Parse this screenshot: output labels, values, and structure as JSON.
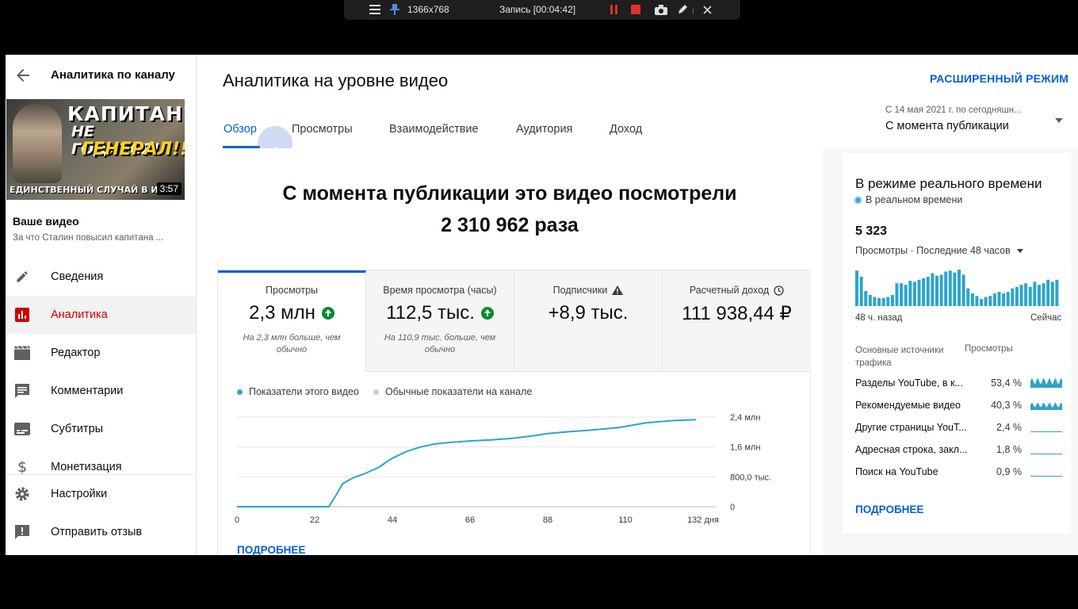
{
  "recorder": {
    "resolution": "1366x768",
    "status": "Запись [00:04:42]"
  },
  "sidebar": {
    "title": "Аналитика по каналу",
    "thumbnail": {
      "line1": "КАПИТАН?",
      "line2": "НЕ ГОДИТСЯ!",
      "line3": "ГЕНЕРАЛ!!!",
      "line4": "ЕДИНСТВЕННЫЙ СЛУЧАЙ В ИСТ",
      "duration": "3:57"
    },
    "video_label": "Ваше видео",
    "video_title": "За что Сталин повысил капитана ...",
    "items": [
      {
        "label": "Сведения",
        "icon": "pencil-icon"
      },
      {
        "label": "Аналитика",
        "icon": "analytics-icon",
        "active": true
      },
      {
        "label": "Редактор",
        "icon": "clapperboard-icon"
      },
      {
        "label": "Комментарии",
        "icon": "comment-icon"
      },
      {
        "label": "Субтитры",
        "icon": "subtitles-icon"
      },
      {
        "label": "Монетизация",
        "icon": "dollar-icon"
      }
    ],
    "bottom_items": [
      {
        "label": "Настройки",
        "icon": "gear-icon"
      },
      {
        "label": "Отправить отзыв",
        "icon": "feedback-icon"
      }
    ]
  },
  "header": {
    "title": "Аналитика на уровне видео",
    "advanced_mode": "РАСШИРЕННЫЙ РЕЖИМ",
    "tabs": [
      "Обзор",
      "Просмотры",
      "Взаимодействие",
      "Аудитория",
      "Доход"
    ],
    "date_range_sub": "С 14 мая 2021 г. по сегодняшн...",
    "date_range_value": "С момента публикации"
  },
  "overview": {
    "headline_line1": "С момента публикации это видео посмотрели",
    "headline_line2": "2 310 962 раза",
    "metrics": [
      {
        "title": "Просмотры",
        "value": "2,3 млн",
        "note": "На 2,3 млн больше, чем обычно",
        "trend": "up"
      },
      {
        "title": "Время просмотра (часы)",
        "value": "112,5 тыс.",
        "note": "На 110,9 тыс. больше, чем обычно",
        "trend": "up"
      },
      {
        "title": "Подписчики",
        "value": "+8,9 тыс.",
        "note": "",
        "trend": "warning"
      },
      {
        "title": "Расчетный доход",
        "value": "111 938,44 ₽",
        "note": "",
        "trend": "clock"
      }
    ],
    "legend": [
      "Показатели этого видео",
      "Обычные показатели на канале"
    ],
    "more": "ПОДРОБНЕЕ",
    "colors": {
      "series": "#2ea4c9",
      "typical": "#cccccc",
      "accent": "#065fd4"
    }
  },
  "chart_data": {
    "type": "line",
    "x_tick_labels": [
      "0",
      "22",
      "44",
      "66",
      "88",
      "110",
      "132 дня"
    ],
    "y_tick_labels": [
      "0",
      "800,0 тыс.",
      "1,6 млн",
      "2,4 млн"
    ],
    "xlim": [
      0,
      132
    ],
    "ylim": [
      0,
      2400000
    ],
    "series": [
      {
        "name": "Показатели этого видео",
        "x": [
          0,
          26,
          28,
          30,
          33,
          36,
          40,
          44,
          48,
          52,
          56,
          60,
          66,
          72,
          78,
          84,
          88,
          94,
          100,
          108,
          116,
          124,
          130
        ],
        "y": [
          0,
          0,
          300000,
          620000,
          780000,
          880000,
          1050000,
          1300000,
          1480000,
          1600000,
          1680000,
          1720000,
          1760000,
          1790000,
          1830000,
          1900000,
          1960000,
          2010000,
          2050000,
          2120000,
          2250000,
          2310000,
          2330000
        ]
      }
    ]
  },
  "realtime": {
    "title": "В режиме реального времени",
    "live_label": "В реальном времени",
    "count": "5 323",
    "views_label": "Просмотры · Последние 48 часов",
    "axis_left": "48 ч. назад",
    "axis_right": "Сейчас",
    "bars": [
      70,
      58,
      30,
      22,
      18,
      16,
      16,
      18,
      22,
      45,
      45,
      42,
      50,
      48,
      52,
      55,
      58,
      65,
      60,
      62,
      68,
      70,
      66,
      72,
      62,
      35,
      25,
      20,
      14,
      18,
      20,
      25,
      28,
      25,
      28,
      35,
      38,
      42,
      45,
      38,
      48,
      42,
      45,
      52,
      48,
      52
    ],
    "sources_header": "Основные источники трафика",
    "sources_value_header": "Просмотры",
    "sources": [
      {
        "name": "Разделы YouTube, в к...",
        "pct": "53,4 %",
        "level": 0.534
      },
      {
        "name": "Рекомендуемые видео",
        "pct": "40,3 %",
        "level": 0.403
      },
      {
        "name": "Другие страницы YouT...",
        "pct": "2,4 %",
        "level": 0.024
      },
      {
        "name": "Адресная строка, закл...",
        "pct": "1,8 %",
        "level": 0.018
      },
      {
        "name": "Поиск на YouTube",
        "pct": "0,9 %",
        "level": 0.009
      }
    ],
    "more": "ПОДРОБНЕЕ"
  }
}
